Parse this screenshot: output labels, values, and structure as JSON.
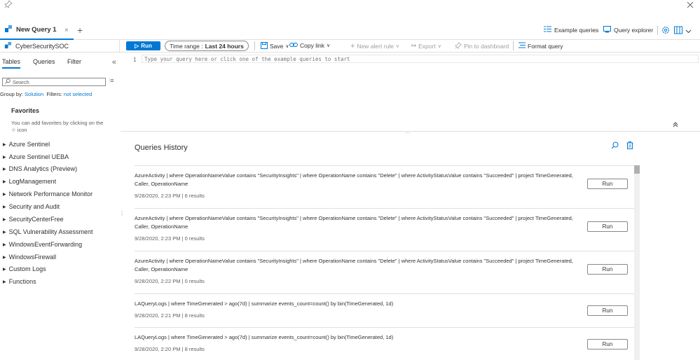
{
  "tab": {
    "title": "New Query 1",
    "close": "×",
    "add": "+"
  },
  "top_right": {
    "example_queries": "Example queries",
    "query_explorer": "Query explorer"
  },
  "workspace": {
    "name": "CyberSecuritySOC"
  },
  "toolbar": {
    "run": "Run",
    "time_range_label": "Time range :",
    "time_range_value": "Last 24 hours",
    "save": "Save",
    "copy_link": "Copy link",
    "new_alert": "New alert rule",
    "export": "Export",
    "pin": "Pin to dashboard",
    "format": "Format query"
  },
  "left": {
    "tabs": {
      "tables": "Tables",
      "queries": "Queries",
      "filter": "Filter"
    },
    "search_placeholder": "Search",
    "group_by_label": "Group by:",
    "group_by_value": "Solution",
    "filters_label": "Filters:",
    "filters_value": "not selected",
    "favorites_title": "Favorites",
    "favorites_hint": "You can add favorites by clicking on the ☆ icon",
    "solutions": [
      "Azure Sentinel",
      "Azure Sentinel UEBA",
      "DNS Analytics (Preview)",
      "LogManagement",
      "Network Performance Monitor",
      "Security and Audit",
      "SecurityCenterFree",
      "SQL Vulnerability Assessment",
      "WindowsEventForwarding",
      "WindowsFirewall",
      "Custom Logs",
      "Functions"
    ]
  },
  "editor": {
    "line_number": "1",
    "placeholder": "Type your query here or click one of the example queries to start"
  },
  "history": {
    "title": "Queries History",
    "run_label": "Run",
    "entries": [
      {
        "query": "AzureActivity | where OperationNameValue contains \"SecurityInsights\" | where OperationName contains \"Delete\" | where ActivityStatusValue contains \"Succeeded\" | project TimeGenerated, Caller, OperationName",
        "meta": "9/28/2020, 2:23 PM | 6 results"
      },
      {
        "query": "AzureActivity | where OperationNameValue contains \"SecurityInsights\" | where OperationName contains \"Delete\" | where ActivityStatusValue contains \"Succeeded\" | project TimeGenerated, Caller, OperationName",
        "meta": "9/28/2020, 2:23 PM | 0 results"
      },
      {
        "query": "AzureActivity | where OperationNameValue contains \"SecurityInsights\" | where OperationName contains \"Delete\" | where ActivityStatusValue contains \"Succeeded\" | project TimeGenerated, Caller, OperationName",
        "meta": "9/28/2020, 2:22 PM | 0 results"
      },
      {
        "query": "LAQueryLogs | where TimeGenerated > ago(7d) | summarize events_count=count() by bin(TimeGenerated, 1d)",
        "meta": "9/28/2020, 2:21 PM | 8 results"
      },
      {
        "query": "LAQueryLogs | where TimeGenerated > ago(7d) | summarize events_count=count() by bin(TimeGenerated, 1d)",
        "meta": "9/28/2020, 2:20 PM | 8 results"
      }
    ]
  },
  "colors": {
    "accent": "#0078d4",
    "border": "#e1dfdd",
    "text": "#323130"
  }
}
